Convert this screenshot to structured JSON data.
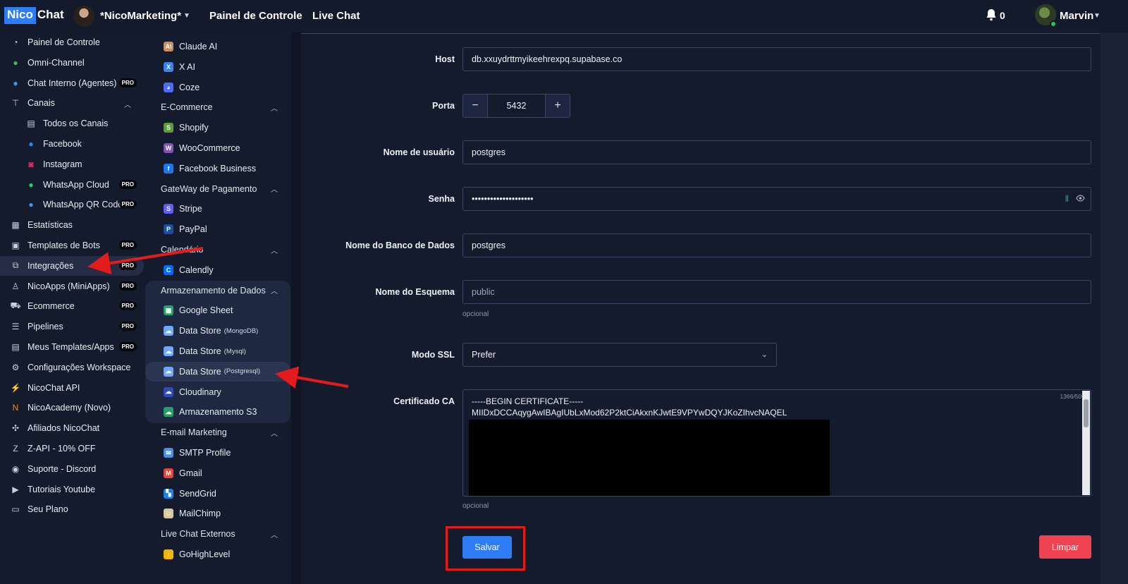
{
  "topbar": {
    "logo_left": "Nico",
    "logo_right": "Chat",
    "workspace_name": "*NicoMarketing*",
    "nav": [
      "Painel de Controle",
      "Live Chat"
    ],
    "notifications": "0",
    "user_name": "Marvin"
  },
  "sidebar": {
    "items": [
      {
        "label": "Painel de Controle",
        "icon": "gauge-icon"
      },
      {
        "label": "Omni-Channel",
        "icon": "chat-bubbles-icon"
      },
      {
        "label": "Chat Interno (Agentes)",
        "icon": "agent-icon",
        "badge": "PRO"
      },
      {
        "label": "Canais",
        "icon": "sitemap-icon"
      },
      {
        "label": "Todos os Canais",
        "icon": "list-icon",
        "sub": true
      },
      {
        "label": "Facebook",
        "icon": "messenger-icon",
        "sub": true
      },
      {
        "label": "Instagram",
        "icon": "instagram-icon",
        "sub": true
      },
      {
        "label": "WhatsApp Cloud",
        "icon": "whatsapp-icon",
        "sub": true,
        "badge": "PRO"
      },
      {
        "label": "WhatsApp QR Code",
        "icon": "whatsapp-qr-icon",
        "sub": true,
        "badge": "PRO"
      },
      {
        "label": "Estatísticas",
        "icon": "chart-icon"
      },
      {
        "label": "Templates de Bots",
        "icon": "template-icon",
        "badge": "PRO"
      },
      {
        "label": "Integrações",
        "icon": "integrations-icon",
        "badge": "PRO",
        "active": true
      },
      {
        "label": "NicoApps (MiniApps)",
        "icon": "user-app-icon",
        "badge": "PRO"
      },
      {
        "label": "Ecommerce",
        "icon": "cart-icon",
        "badge": "PRO"
      },
      {
        "label": "Pipelines",
        "icon": "pipeline-icon",
        "badge": "PRO"
      },
      {
        "label": "Meus Templates/Apps",
        "icon": "doc-icon",
        "badge": "PRO"
      },
      {
        "label": "Configurações Workspace",
        "icon": "gear-icon"
      },
      {
        "label": "NicoChat API",
        "icon": "api-icon"
      },
      {
        "label": "NicoAcademy (Novo)",
        "icon": "n-logo-icon"
      },
      {
        "label": "Afiliados NicoChat",
        "icon": "affiliate-icon"
      },
      {
        "label": "Z-API - 10% OFF",
        "icon": "zapi-icon"
      },
      {
        "label": "Suporte - Discord",
        "icon": "discord-icon"
      },
      {
        "label": "Tutoriais Youtube",
        "icon": "youtube-icon"
      },
      {
        "label": "Seu Plano",
        "icon": "card-icon"
      }
    ]
  },
  "integrations": {
    "rows": [
      {
        "kind": "item",
        "label": "Claude AI",
        "icon": "claude-icon",
        "color": "#c98b5f"
      },
      {
        "kind": "item",
        "label": "X AI",
        "icon": "xai-icon",
        "color": "#3b82f6"
      },
      {
        "kind": "item",
        "label": "Coze",
        "icon": "coze-icon",
        "color": "#4f6bff"
      },
      {
        "kind": "head",
        "label": "E-Commerce"
      },
      {
        "kind": "item",
        "label": "Shopify",
        "icon": "shopify-icon",
        "color": "#5e9e3a"
      },
      {
        "kind": "item",
        "label": "WooCommerce",
        "icon": "woocommerce-icon",
        "color": "#7f54b3"
      },
      {
        "kind": "item",
        "label": "Facebook Business",
        "icon": "facebook-icon",
        "color": "#1877f2"
      },
      {
        "kind": "head",
        "label": "GateWay de Pagamento"
      },
      {
        "kind": "item",
        "label": "Stripe",
        "icon": "stripe-icon",
        "color": "#635bff"
      },
      {
        "kind": "item",
        "label": "PayPal",
        "icon": "paypal-icon",
        "color": "#1e4e9b"
      },
      {
        "kind": "head",
        "label": "Calendário"
      },
      {
        "kind": "item",
        "label": "Calendly",
        "icon": "calendly-icon",
        "color": "#006bff"
      },
      {
        "kind": "head",
        "label": "Armazenamento de Dados"
      },
      {
        "kind": "item",
        "label": "Google Sheet",
        "icon": "sheets-icon",
        "color": "#23a566"
      },
      {
        "kind": "item",
        "label": "Data Store",
        "small": "(MongoDB)",
        "icon": "cloud-db-icon",
        "color": "#6fa8ff"
      },
      {
        "kind": "item",
        "label": "Data Store",
        "small": "(Mysql)",
        "icon": "cloud-db-icon",
        "color": "#6fa8ff"
      },
      {
        "kind": "item",
        "label": "Data Store",
        "small": "(Postgresql)",
        "icon": "cloud-db-icon",
        "color": "#6fa8ff",
        "active": true
      },
      {
        "kind": "item",
        "label": "Cloudinary",
        "icon": "cloudinary-icon",
        "color": "#3448c5"
      },
      {
        "kind": "item",
        "label": "Armazenamento S3",
        "icon": "s3-icon",
        "color": "#1fa463"
      },
      {
        "kind": "head",
        "label": "E-mail Marketing"
      },
      {
        "kind": "item",
        "label": "SMTP Profile",
        "icon": "smtp-icon",
        "color": "#4a90e2"
      },
      {
        "kind": "item",
        "label": "Gmail",
        "icon": "gmail-icon",
        "color": "#ea4335"
      },
      {
        "kind": "item",
        "label": "SendGrid",
        "icon": "sendgrid-icon",
        "color": "#1a82e2"
      },
      {
        "kind": "item",
        "label": "MailChimp",
        "icon": "mailchimp-icon",
        "color": "#d9c7a0"
      },
      {
        "kind": "head",
        "label": "Live Chat Externos"
      },
      {
        "kind": "item",
        "label": "GoHighLevel",
        "icon": "gohighlevel-icon",
        "color": "#f5b400"
      }
    ]
  },
  "form": {
    "host_label": "Host",
    "host_value": "db.xxuydrttmyikeehrexpq.supabase.co",
    "port_label": "Porta",
    "port_value": "5432",
    "port_minus": "−",
    "port_plus": "+",
    "user_label": "Nome de usuário",
    "user_value": "postgres",
    "password_label": "Senha",
    "password_value": "••••••••••••••••••••",
    "db_label": "Nome do Banco de Dados",
    "db_value": "postgres",
    "schema_label": "Nome do Esquema",
    "schema_placeholder": "public",
    "schema_hint": "opcional",
    "ssl_label": "Modo SSL",
    "ssl_value": "Prefer",
    "ca_label": "Certificado CA",
    "ca_line1": "-----BEGIN CERTIFICATE-----",
    "ca_line2": "MIIDxDCCAqygAwIBAgIUbLxMod62P2ktCiAkxnKJwtE9VPYwDQYJKoZIhvcNAQEL",
    "ca_counter": "1366/500",
    "ca_hint": "opcional",
    "save_label": "Salvar",
    "clear_label": "Limpar"
  },
  "colors": {
    "accent": "#2f7df6",
    "danger": "#ef4352",
    "annotation": "#e31b1b"
  }
}
